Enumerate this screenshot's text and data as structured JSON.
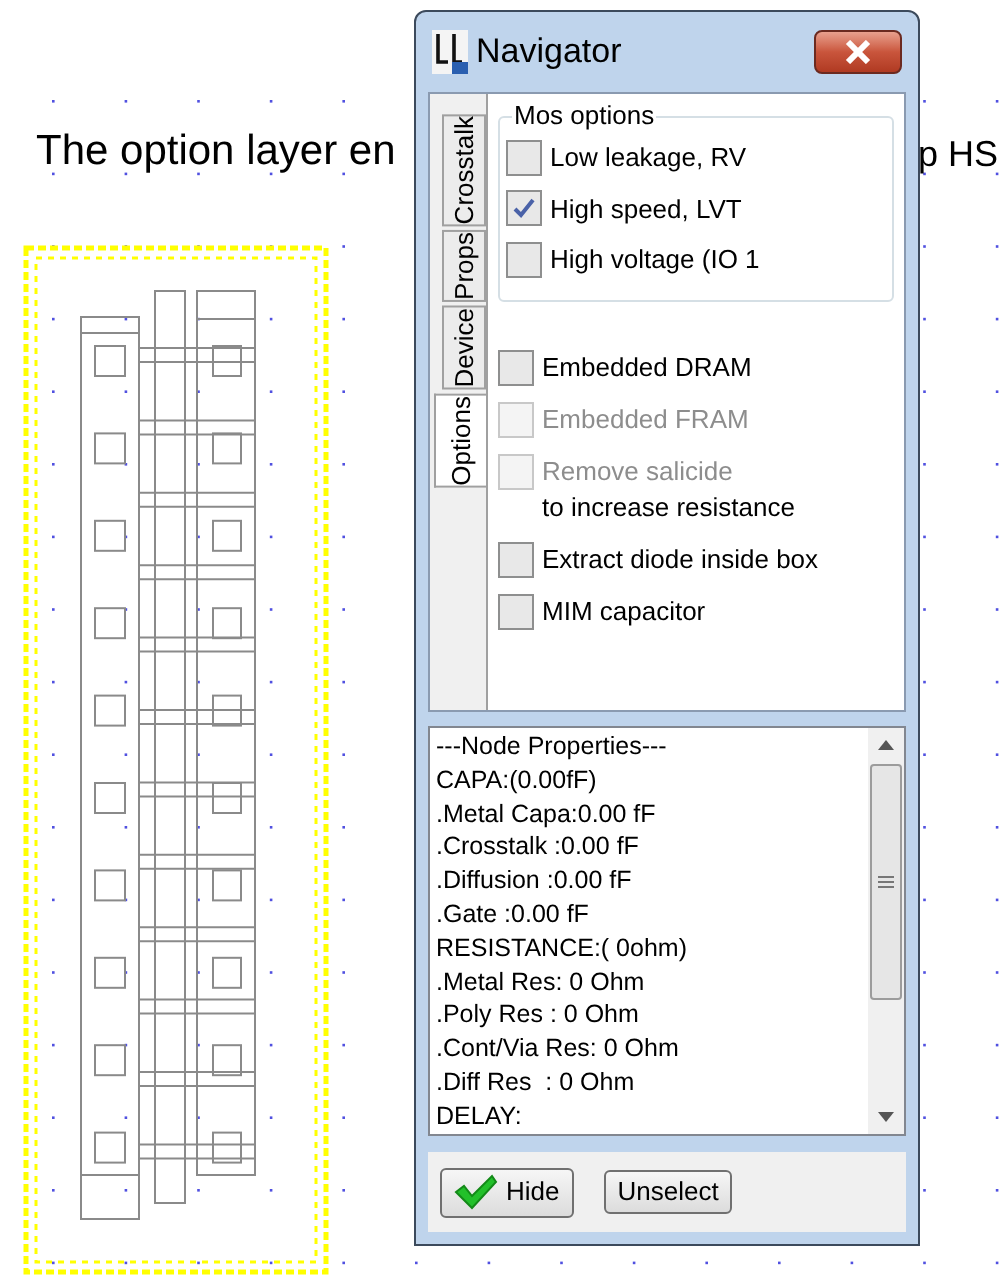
{
  "canvas": {
    "text_left": "The option layer en",
    "text_right": "p HS"
  },
  "window": {
    "title": "Navigator"
  },
  "tabs": [
    {
      "label": "Crosstalk",
      "selected": false
    },
    {
      "label": "Props",
      "selected": false
    },
    {
      "label": "Device",
      "selected": false
    },
    {
      "label": "Options",
      "selected": true
    }
  ],
  "mos_options": {
    "title": "Mos options",
    "items": [
      {
        "label": "Low leakage, RV",
        "checked": false
      },
      {
        "label": "High speed, LVT",
        "checked": true
      },
      {
        "label": "High voltage (IO 1",
        "checked": false
      }
    ]
  },
  "options": [
    {
      "label": "Embedded DRAM",
      "checked": false,
      "disabled": false
    },
    {
      "label": "Embedded FRAM",
      "checked": false,
      "disabled": true
    },
    {
      "label": "Remove salicide",
      "note": "to increase resistance",
      "checked": false,
      "disabled": true
    },
    {
      "label": "Extract diode inside box",
      "checked": false,
      "disabled": false
    },
    {
      "label": "MIM capacitor",
      "checked": false,
      "disabled": false
    }
  ],
  "properties": {
    "lines": [
      "---Node Properties---",
      "CAPA:(0.00fF)",
      ".Metal Capa:0.00 fF",
      ".Crosstalk :0.00 fF",
      ".Diffusion :0.00 fF",
      ".Gate :0.00 fF",
      "RESISTANCE:( 0ohm)",
      ".Metal Res: 0 Ohm",
      ".Poly Res : 0 Ohm",
      ".Cont/Via Res: 0 Ohm",
      ".Diff Res  : 0 Ohm",
      "DELAY:"
    ]
  },
  "buttons": [
    {
      "label": "Hide",
      "kind": "confirm"
    },
    {
      "label": "Unselect",
      "kind": "plain"
    }
  ]
}
